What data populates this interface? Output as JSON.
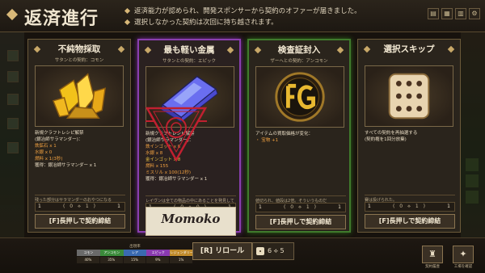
{
  "header": {
    "title": "返済進行",
    "notes": [
      "返済能力が認められ、開発スポンサーから契約のオファーが届きました。",
      "選択しなかった契約は次回に持ち越されます。"
    ]
  },
  "cards": [
    {
      "title": "不純物採取",
      "subtitle": "サタンとの契約：コモン",
      "desc": [
        "新規クラフトレシピ解禁",
        "(銀冶師サラマンダー)：",
        "鉄鉱石 x 1",
        "水銀 x 0",
        "燃料 x 1(3秒)",
        "獲得：銀冶師サラマンダー x 1"
      ],
      "foot": "残った部分はサラマンダーのおやつになる",
      "counter": [
        "1",
        "( 0 ⟡ 1 )",
        "1"
      ],
      "button": "[F]長押しで契約締結"
    },
    {
      "title": "最も軽い金属",
      "subtitle": "サタンとの契約：エピック",
      "desc": [
        "新規クラフトレシピ解禁",
        "(銀冶師サラマンダー)：",
        "鉄インゴット x 8",
        "水銀 x 8",
        "金インゴット x 8",
        "燃料 x 155",
        "ミスリル x 100(12秒)",
        "獲得：銀冶師サラマンダー x 1"
      ],
      "foot": "レイヴンは全ての物品の中にあることを発見していった",
      "counter": [
        "1",
        "( 0 ⟡ 0 )",
        "1"
      ],
      "signature": "Momoko"
    },
    {
      "title": "検査証封入",
      "subtitle": "ザーヘとの契約：アンコモン",
      "desc": [
        "アイテムの買取価格が変化：",
        "・ 宝物 +1"
      ],
      "foot": "値切られ、値段は2倍。そういうものだ",
      "counter": [
        "1",
        "( 0 ⟡ 1 )",
        "1"
      ],
      "button": "[F]長押しで契約締結"
    },
    {
      "title": "選択スキップ",
      "subtitle": "",
      "desc": [
        "すべての契約を再抽選する",
        "(契約権を1回分放棄)"
      ],
      "foot": "賽は投げられた。",
      "counter": [
        "1",
        "( 0 ⟡ 1 )",
        "1"
      ],
      "button": "[F]長押しで契約締結"
    }
  ],
  "rarity": {
    "title": "出現率",
    "labels": [
      "コモン",
      "アンコモン",
      "レア",
      "エピック",
      "レジェンダリー"
    ],
    "values": [
      "40%",
      "35%",
      "15%",
      "9%",
      "1%"
    ],
    "colors": [
      "#6a6a6a",
      "#3a8a3a",
      "#3a6ab0",
      "#8a3ab0",
      "#c08a2a"
    ]
  },
  "bottom": {
    "reroll": "[R] リロール",
    "reroll_count": "6 ⟡ 5",
    "btn_contract_label": "契約履歴",
    "btn_factory_label": "工場を確認"
  }
}
